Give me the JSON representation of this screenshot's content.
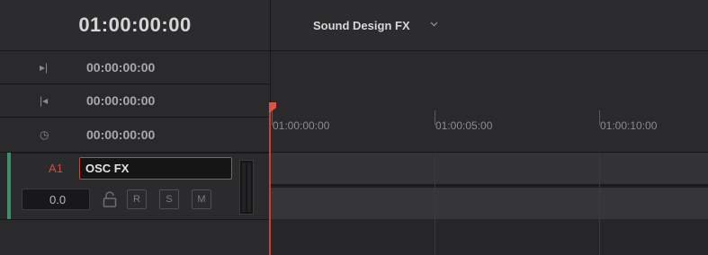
{
  "header": {
    "current_timecode": "01:00:00:00",
    "timeline_name": "Sound Design FX"
  },
  "timecode_rows": [
    {
      "icon": "mark-out-icon",
      "glyph": "▸|",
      "value": "00:00:00:00"
    },
    {
      "icon": "mark-in-icon",
      "glyph": "|◂",
      "value": "00:00:00:00"
    },
    {
      "icon": "duration-clock-icon",
      "glyph": "◷",
      "value": "00:00:00:00"
    }
  ],
  "ruler": {
    "labels": [
      "01:00:00:00",
      "01:00:05:00",
      "01:00:10:00"
    ]
  },
  "track": {
    "id": "A1",
    "name": "OSC FX",
    "volume": "0.0",
    "buttons": [
      "R",
      "S",
      "M"
    ],
    "accent_color": "#3f8f6a"
  },
  "colors": {
    "playhead": "#c64235",
    "track_id": "#d24a3c"
  }
}
